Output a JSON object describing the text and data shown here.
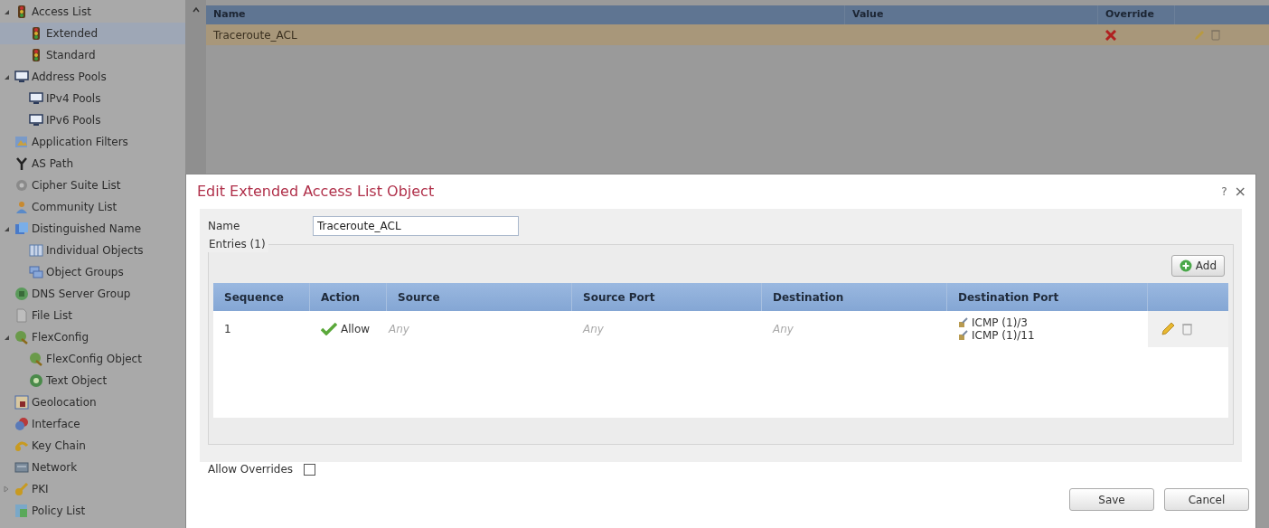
{
  "sidebar": {
    "items": [
      {
        "label": "Access List",
        "expanded": true,
        "selected": false,
        "children": [
          {
            "label": "Extended",
            "selected": true
          },
          {
            "label": "Standard",
            "selected": false
          }
        ]
      },
      {
        "label": "Address Pools",
        "expanded": true,
        "selected": false,
        "children": [
          {
            "label": "IPv4 Pools",
            "selected": false
          },
          {
            "label": "IPv6 Pools",
            "selected": false
          }
        ]
      },
      {
        "label": "Application Filters",
        "selected": false
      },
      {
        "label": "AS Path",
        "selected": false
      },
      {
        "label": "Cipher Suite List",
        "selected": false
      },
      {
        "label": "Community List",
        "selected": false
      },
      {
        "label": "Distinguished Name",
        "expanded": true,
        "selected": false,
        "children": [
          {
            "label": "Individual Objects",
            "selected": false
          },
          {
            "label": "Object Groups",
            "selected": false
          }
        ]
      },
      {
        "label": "DNS Server Group",
        "selected": false
      },
      {
        "label": "File List",
        "selected": false
      },
      {
        "label": "FlexConfig",
        "expanded": true,
        "selected": false,
        "children": [
          {
            "label": "FlexConfig Object",
            "selected": false
          },
          {
            "label": "Text Object",
            "selected": false
          }
        ]
      },
      {
        "label": "Geolocation",
        "selected": false
      },
      {
        "label": "Interface",
        "selected": false
      },
      {
        "label": "Key Chain",
        "selected": false
      },
      {
        "label": "Network",
        "selected": false
      },
      {
        "label": "PKI",
        "expanded": false,
        "selected": false
      },
      {
        "label": "Policy List",
        "selected": false
      }
    ]
  },
  "list_table": {
    "columns": [
      "Name",
      "Value",
      "Override"
    ],
    "rows": [
      {
        "name": "Traceroute_ACL",
        "override": false,
        "selected": true
      }
    ]
  },
  "dialog": {
    "title": "Edit Extended Access List Object",
    "help": "?",
    "close": "×",
    "name_label": "Name",
    "name_value": "Traceroute_ACL",
    "entries_label": "Entries (1)",
    "add_button": "Add",
    "entries_table": {
      "columns": [
        "Sequence",
        "Action",
        "Source",
        "Source Port",
        "Destination",
        "Destination Port"
      ],
      "rows": [
        {
          "sequence": "1",
          "action": "Allow",
          "source": "Any",
          "source_port": "Any",
          "destination": "Any",
          "destination_port": [
            "ICMP (1)/3",
            "ICMP (1)/11"
          ]
        }
      ]
    },
    "allow_overrides": {
      "label": "Allow Overrides",
      "checked": false
    },
    "buttons": [
      "Save",
      "Cancel"
    ]
  }
}
